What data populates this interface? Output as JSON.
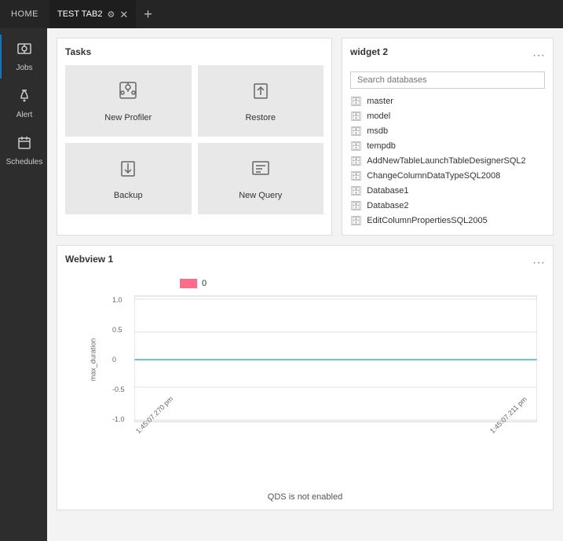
{
  "topbar": {
    "home_label": "HOME",
    "active_tab_label": "TEST TAB2",
    "add_tab_icon": "+"
  },
  "sidebar": {
    "items": [
      {
        "id": "jobs",
        "label": "Jobs",
        "active": true
      },
      {
        "id": "alert",
        "label": "Alert",
        "active": false
      },
      {
        "id": "schedules",
        "label": "Schedules",
        "active": false
      }
    ]
  },
  "tasks_widget": {
    "title": "Tasks",
    "items": [
      {
        "id": "new-profiler",
        "label": "New Profiler"
      },
      {
        "id": "restore",
        "label": "Restore"
      },
      {
        "id": "backup",
        "label": "Backup"
      },
      {
        "id": "new-query",
        "label": "New Query"
      }
    ]
  },
  "widget2": {
    "title": "widget 2",
    "search_placeholder": "Search databases",
    "databases": [
      "master",
      "model",
      "msdb",
      "tempdb",
      "AddNewTableLaunchTableDesignerSQL2",
      "ChangeColumnDataTypeSQL2008",
      "Database1",
      "Database2",
      "EditColumnPropertiesSQL2005"
    ]
  },
  "webview": {
    "title": "Webview 1",
    "legend_label": "0",
    "y_axis_label": "max_duration",
    "x_label_left": "1:45:07.270 pm",
    "x_label_right": "1:45:07.211 pm",
    "chart_note": "QDS is not enabled",
    "y_ticks": [
      "1.0",
      "0.5",
      "0",
      "-0.5",
      "-1.0"
    ]
  }
}
